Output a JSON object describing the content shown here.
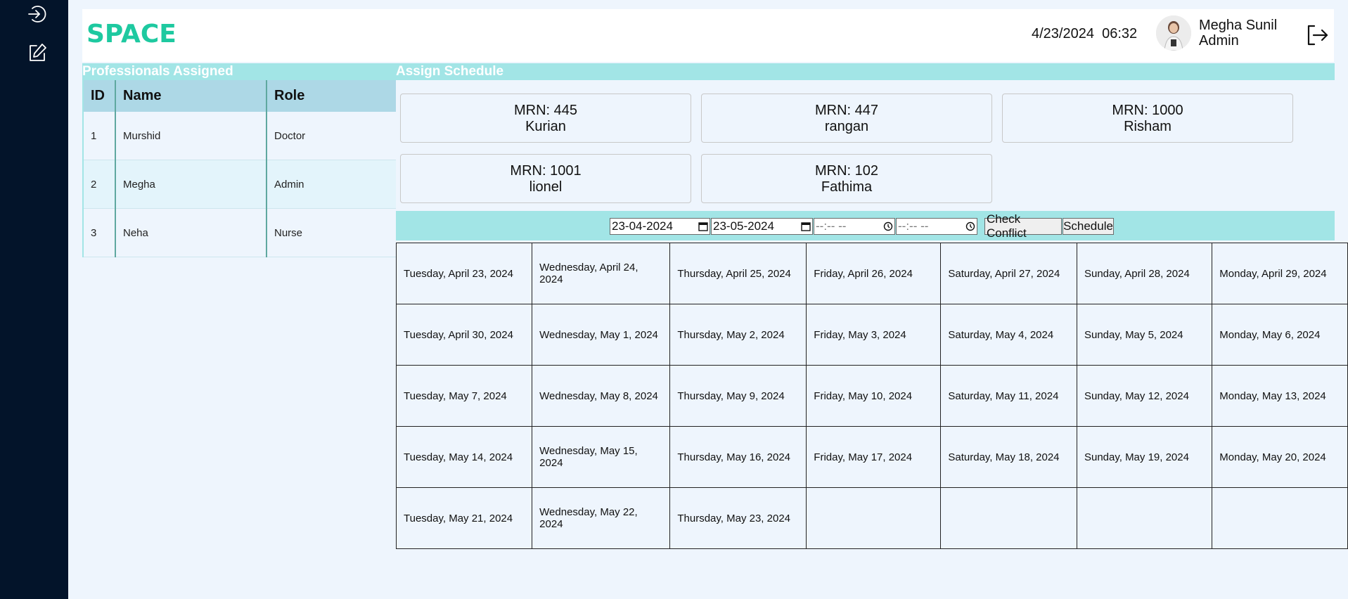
{
  "app": {
    "logo_text": "SPACE",
    "brand_color": "#1ec9a0"
  },
  "sidebar": {
    "icons": [
      "login-icon",
      "edit-icon"
    ]
  },
  "header": {
    "date": "4/23/2024",
    "time": "06:32",
    "user_name": "Megha Sunil",
    "user_role": "Admin"
  },
  "professionals": {
    "title": "Professionals Assigned",
    "columns": [
      "ID",
      "Name",
      "Role"
    ],
    "rows": [
      [
        "1",
        "Murshid",
        "Doctor"
      ],
      [
        "2",
        "Megha",
        "Admin"
      ],
      [
        "3",
        "Neha",
        "Nurse"
      ]
    ]
  },
  "schedule": {
    "title": "Assign Schedule",
    "patients": [
      {
        "mrn": "MRN: 445",
        "name": "Kurian"
      },
      {
        "mrn": "MRN: 447",
        "name": "rangan"
      },
      {
        "mrn": "MRN: 1000",
        "name": "Risham"
      },
      {
        "mrn": "MRN: 1001",
        "name": "lionel"
      },
      {
        "mrn": "MRN: 102",
        "name": "Fathima"
      }
    ],
    "start_date": "23-04-2024",
    "end_date": "23-05-2024",
    "start_time": "--:-- --",
    "end_time": "--:-- --",
    "check_label": "Check Conflict",
    "schedule_label": "Schedule",
    "calendar": [
      [
        "Tuesday, April 23, 2024",
        "Wednesday, April 24, 2024",
        "Thursday, April 25, 2024",
        "Friday, April 26, 2024",
        "Saturday, April 27, 2024",
        "Sunday, April 28, 2024",
        "Monday, April 29, 2024"
      ],
      [
        "Tuesday, April 30, 2024",
        "Wednesday, May 1, 2024",
        "Thursday, May 2, 2024",
        "Friday, May 3, 2024",
        "Saturday, May 4, 2024",
        "Sunday, May 5, 2024",
        "Monday, May 6, 2024"
      ],
      [
        "Tuesday, May 7, 2024",
        "Wednesday, May 8, 2024",
        "Thursday, May 9, 2024",
        "Friday, May 10, 2024",
        "Saturday, May 11, 2024",
        "Sunday, May 12, 2024",
        "Monday, May 13, 2024"
      ],
      [
        "Tuesday, May 14, 2024",
        "Wednesday, May 15, 2024",
        "Thursday, May 16, 2024",
        "Friday, May 17, 2024",
        "Saturday, May 18, 2024",
        "Sunday, May 19, 2024",
        "Monday, May 20, 2024"
      ],
      [
        "Tuesday, May 21, 2024",
        "Wednesday, May 22, 2024",
        "Thursday, May 23, 2024",
        "",
        "",
        "",
        ""
      ]
    ]
  }
}
